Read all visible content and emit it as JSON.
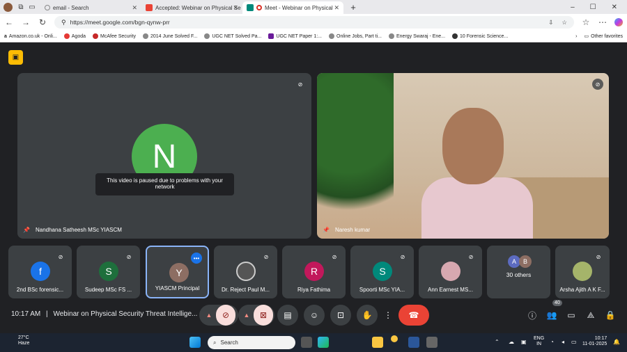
{
  "browser": {
    "tabs": [
      {
        "title": "email - Search",
        "icon_color": "#888"
      },
      {
        "title": "Accepted: Webinar on Physical Se",
        "icon_color": "#ea4335"
      },
      {
        "title": "Meet - Webinar on Physical",
        "icon_color": "#00897b",
        "active": true
      }
    ],
    "new_tab": "+",
    "window_controls": [
      "–",
      "☐",
      "✕"
    ],
    "url": "https://meet.google.com/bgn-qynw-prr",
    "bookmarks": [
      "Amazon.co.uk - Onli...",
      "Agoda",
      "McAfee Security",
      "2014 June Solved F...",
      "UGC NET Solved Pa...",
      "UGC NET Paper 1:...",
      "Online Jobs, Part ti...",
      "Energy Swaraj - Ene...",
      "10 Forensic Science..."
    ],
    "other_favorites": "Other favorites"
  },
  "meet": {
    "main_tiles": [
      {
        "name": "Nandhana Satheesh MSc YIASCM",
        "initial": "N",
        "avatar_color": "#4caf50",
        "message": "This video is paused due to problems with your network"
      },
      {
        "name": "Naresh kumar"
      }
    ],
    "strip": [
      {
        "name": "2nd BSc forensic...",
        "initial": "f",
        "color": "#1a73e8"
      },
      {
        "name": "Sudeep MSc FS ...",
        "initial": "S",
        "color": "#1e6f3c"
      },
      {
        "name": "YIASCM Principal",
        "initial": "Y",
        "color": "#8d6e63",
        "speaking": true
      },
      {
        "name": "Dr. Reject Paul M...",
        "initial": "",
        "color": "#555"
      },
      {
        "name": "Riya Fathima",
        "initial": "R",
        "color": "#c2185b"
      },
      {
        "name": "Spoorti MSc YIA...",
        "initial": "S",
        "color": "#00897b"
      },
      {
        "name": "Ann Earnest MS...",
        "initial": "",
        "color": "#d7a8b0"
      },
      {
        "name": "30 others",
        "initials": [
          "A",
          "B"
        ]
      },
      {
        "name": "Arsha Ajith A K F...",
        "initial": "",
        "color": "#a5b46a"
      }
    ],
    "time": "10:17 AM",
    "separator": "|",
    "meeting_title": "Webinar on Physical Security Threat Intellige...",
    "participant_count": "40"
  },
  "taskbar": {
    "temperature": "27°C",
    "weather": "Haze",
    "search_placeholder": "Search",
    "lang1": "ENG",
    "lang2": "IN",
    "time": "10:17",
    "date": "11-01-2025"
  }
}
